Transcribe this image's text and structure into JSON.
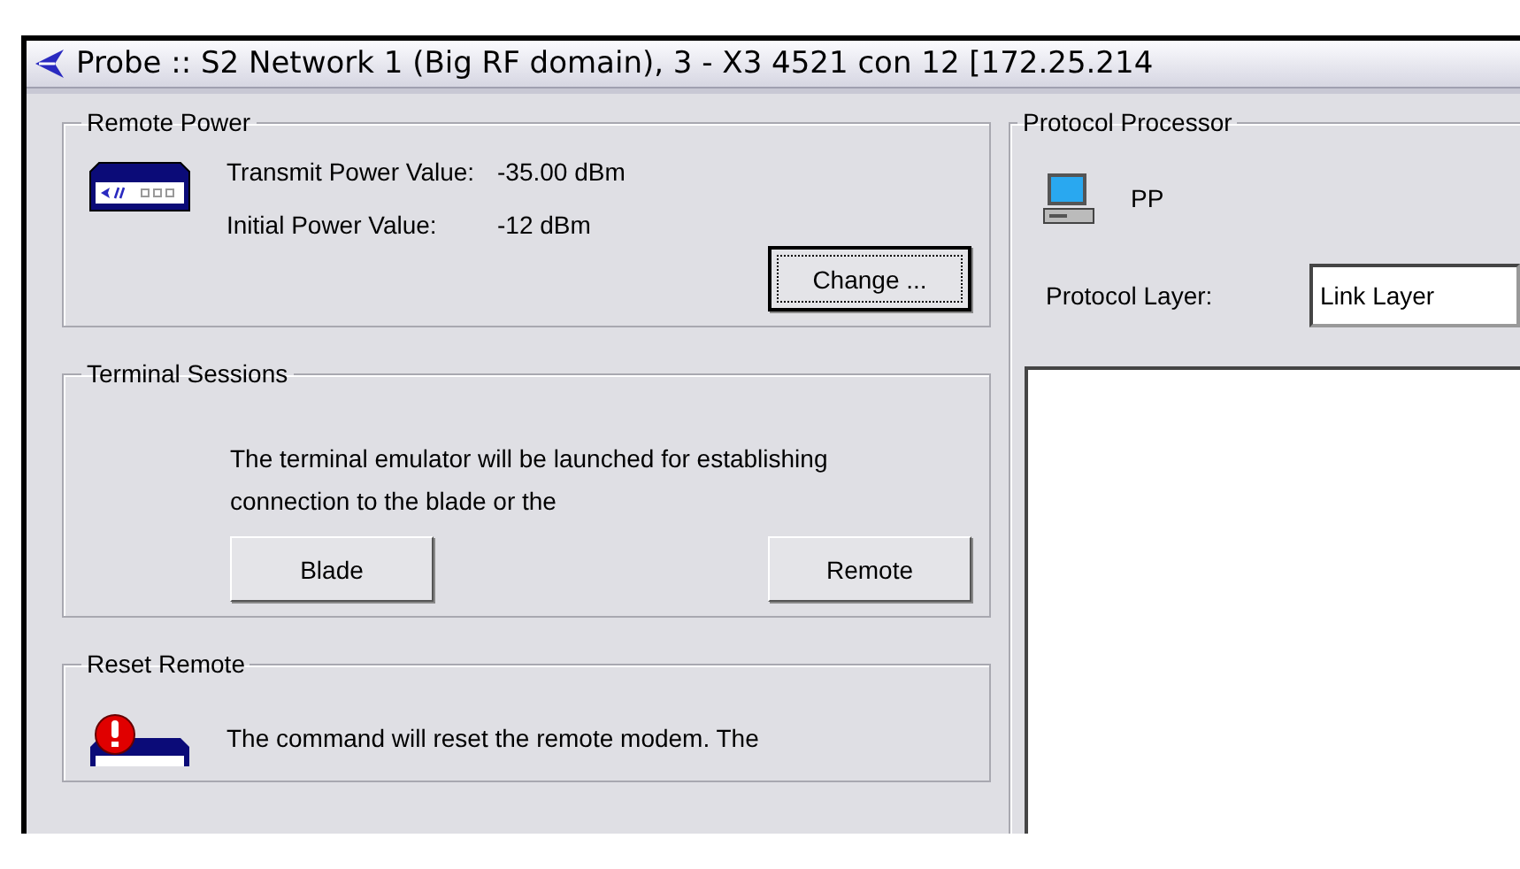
{
  "window": {
    "title": "Probe :: S2 Network 1 (Big RF domain), 3 - X3 4521 con 12 [172.25.214"
  },
  "remote_power": {
    "title": "Remote Power",
    "rows": [
      {
        "label": "Transmit Power Value:",
        "value": "-35.00 dBm"
      },
      {
        "label": "Initial Power Value:",
        "value": "-12 dBm"
      }
    ],
    "button": "Change ..."
  },
  "terminal_sessions": {
    "title": "Terminal Sessions",
    "text": "The terminal emulator will be launched for establishing connection to the blade or the",
    "buttons": [
      "Blade",
      "Remote"
    ]
  },
  "reset_remote": {
    "title": "Reset Remote",
    "text": "The command will reset the remote modem. The"
  },
  "protocol_processor": {
    "title": "Protocol Processor",
    "name": "PP",
    "layer_label": "Protocol Layer:",
    "layer_value": "Link Layer"
  }
}
